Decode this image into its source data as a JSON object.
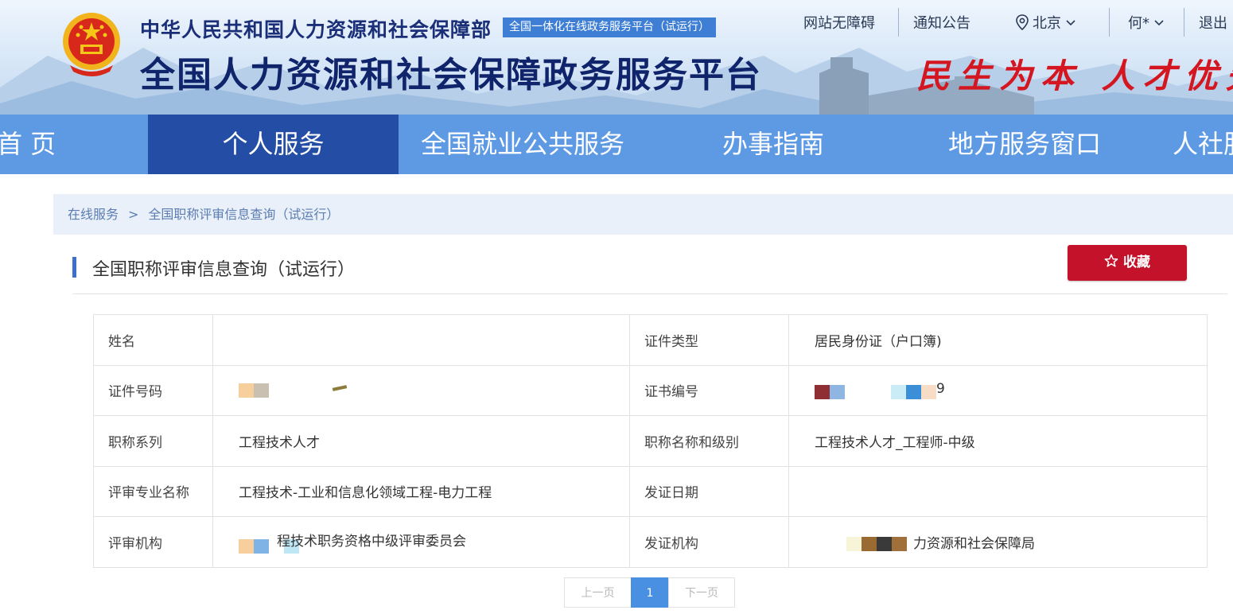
{
  "header": {
    "ministry": "中华人民共和国人力资源和社会保障部",
    "platform_badge": "全国一体化在线政务服务平台（试运行）",
    "main_title": "全国人力资源和社会保障政务服务平台",
    "slogan": "民生为本 人才优先",
    "links": {
      "accessibility": "网站无障碍",
      "notice": "通知公告",
      "location": "北京",
      "user": "何*",
      "logout": "退出"
    }
  },
  "nav": {
    "items": [
      "首 页",
      "个人服务",
      "全国就业公共服务",
      "办事指南",
      "地方服务窗口",
      "人社服"
    ],
    "active_index": 1
  },
  "breadcrumb": {
    "items": [
      "在线服务",
      "全国职称评审信息查询（试运行）"
    ],
    "separator": ">"
  },
  "section": {
    "title": "全国职称评审信息查询（试运行）",
    "favorite_label": "收藏"
  },
  "record": {
    "rows": [
      {
        "label_left": "姓名",
        "value_left": "",
        "label_right": "证件类型",
        "value_right": "居民身份证（户口簿)"
      },
      {
        "label_left": "证件号码",
        "value_left": "",
        "label_right": "证书编号",
        "value_right": "9"
      },
      {
        "label_left": "职称系列",
        "value_left": "工程技术人才",
        "label_right": "职称名称和级别",
        "value_right": "工程技术人才_工程师-中级"
      },
      {
        "label_left": "评审专业名称",
        "value_left": "工程技术-工业和信息化领域工程-电力工程",
        "label_right": "发证日期",
        "value_right": ""
      },
      {
        "label_left": "评审机构",
        "value_left": "程技术职务资格中级评审委员会",
        "label_right": "发证机构",
        "value_right": "力资源和社会保障局"
      }
    ]
  },
  "pager": {
    "prev": "上一页",
    "current": "1",
    "next": "下一页"
  },
  "colors": {
    "nav_bg": "#5d9ae3",
    "nav_active": "#244ea5",
    "favorite_button": "#c4122b",
    "breadcrumb_bg": "#e9f0fa",
    "badge_bg": "#3e7fd5",
    "slogan": "#d3161f"
  }
}
